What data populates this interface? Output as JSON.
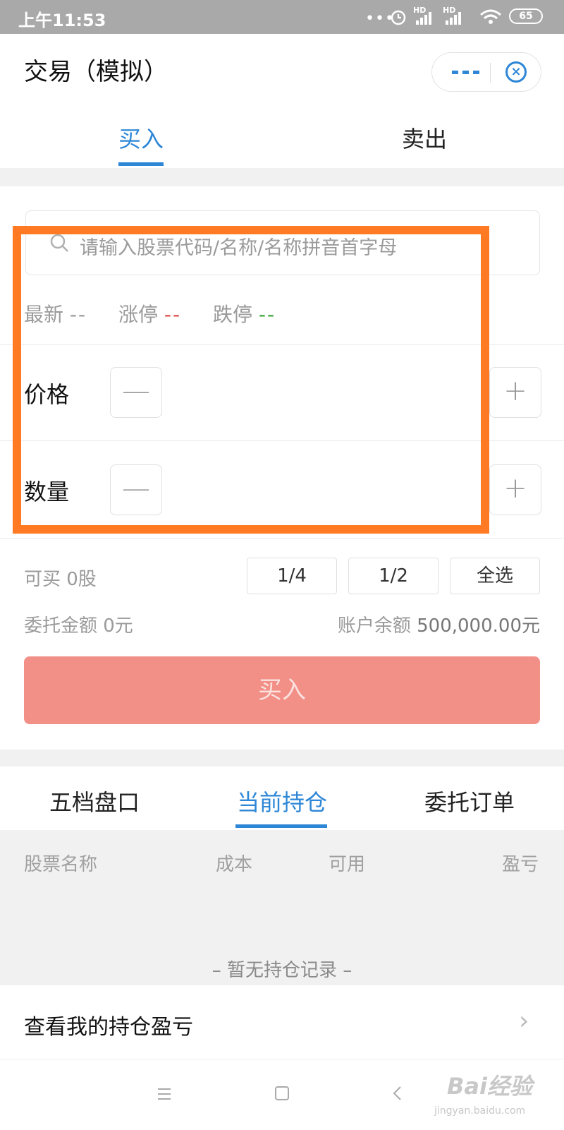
{
  "status_bar": {
    "time": "上午11:53",
    "battery": "65",
    "network_1": "HD",
    "network_2": "HD"
  },
  "header": {
    "title": "交易（模拟）",
    "more_icon": "more-dots-icon",
    "close_icon": "close-target-icon"
  },
  "tabs": [
    {
      "label": "买入",
      "active": true
    },
    {
      "label": "卖出",
      "active": false
    }
  ],
  "search": {
    "placeholder": "请输入股票代码/名称/名称拼音首字母"
  },
  "price_info": {
    "latest_label": "最新",
    "latest_value": "--",
    "limit_up_label": "涨停",
    "limit_up_value": "--",
    "limit_down_label": "跌停",
    "limit_down_value": "--"
  },
  "form": {
    "price_label": "价格",
    "quantity_label": "数量",
    "price_value": "",
    "quantity_value": ""
  },
  "quick": {
    "can_buy": "可买 0股",
    "quarter": "1/4",
    "half": "1/2",
    "all": "全选"
  },
  "summary": {
    "entrust_amount": "委托金额 0元",
    "balance_label": "账户余额",
    "balance_value": "500,000.00元"
  },
  "buy_button": "买入",
  "bottom_tabs": [
    {
      "label": "五档盘口",
      "active": false
    },
    {
      "label": "当前持仓",
      "active": true
    },
    {
      "label": "委托订单",
      "active": false
    }
  ],
  "holdings_table": {
    "columns": [
      "股票名称",
      "成本",
      "可用",
      "盈亏"
    ],
    "empty_text": "– 暂无持仓记录 –"
  },
  "view_pl_link": "查看我的持仓盈亏",
  "watermark": {
    "main": "Bai经验",
    "sub": "jingyan.baidu.com"
  },
  "colors": {
    "accent": "#2d86d6",
    "limit_up": "#e04848",
    "limit_down": "#3aa33a",
    "buy_button": "#f28f87",
    "highlight": "#ff7a22"
  }
}
